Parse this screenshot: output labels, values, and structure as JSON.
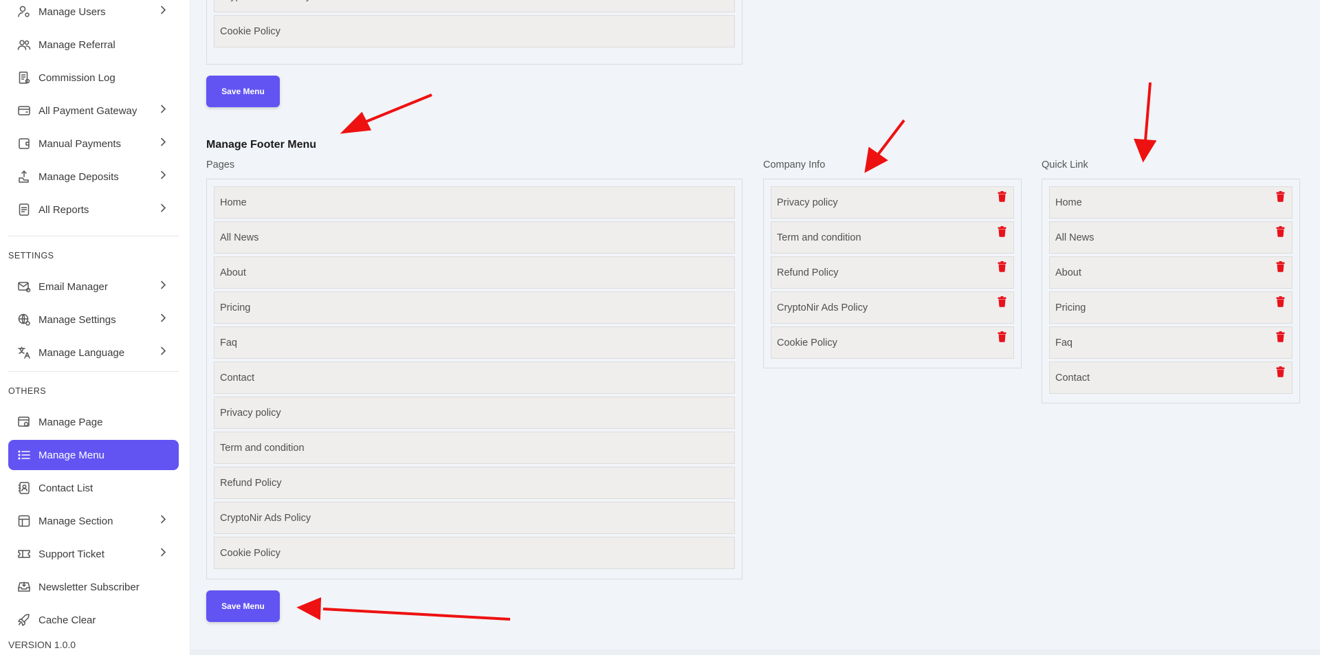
{
  "sidebar": {
    "items_top": [
      {
        "label": "Manage Users",
        "icon": "user-gear-icon",
        "chevron": true
      },
      {
        "label": "Manage Referral",
        "icon": "users-icon",
        "chevron": false
      },
      {
        "label": "Commission Log",
        "icon": "receipt-icon",
        "chevron": false
      },
      {
        "label": "All Payment Gateway",
        "icon": "wallet-icon",
        "chevron": true
      },
      {
        "label": "Manual Payments",
        "icon": "wallet-alt-icon",
        "chevron": true
      },
      {
        "label": "Manage Deposits",
        "icon": "deposit-icon",
        "chevron": true
      },
      {
        "label": "All Reports",
        "icon": "report-icon",
        "chevron": true
      }
    ],
    "settings_title": "SETTINGS",
    "items_settings": [
      {
        "label": "Email Manager",
        "icon": "mail-gear-icon",
        "chevron": true
      },
      {
        "label": "Manage Settings",
        "icon": "globe-gear-icon",
        "chevron": true
      },
      {
        "label": "Manage Language",
        "icon": "translate-icon",
        "chevron": true
      }
    ],
    "others_title": "OTHERS",
    "items_others": [
      {
        "label": "Manage Page",
        "icon": "page-gear-icon",
        "chevron": false
      },
      {
        "label": "Manage Menu",
        "icon": "list-icon",
        "chevron": false,
        "active": true
      },
      {
        "label": "Contact List",
        "icon": "contact-icon",
        "chevron": false
      },
      {
        "label": "Manage Section",
        "icon": "layout-icon",
        "chevron": true
      },
      {
        "label": "Support Ticket",
        "icon": "ticket-icon",
        "chevron": true
      },
      {
        "label": "Newsletter Subscriber",
        "icon": "inbox-icon",
        "chevron": false
      },
      {
        "label": "Cache Clear",
        "icon": "rocket-icon",
        "chevron": false
      }
    ],
    "version": "VERSION 1.0.0"
  },
  "top_section": {
    "items": [
      "CryptoNir Ads Policy",
      "Cookie Policy"
    ],
    "save_label": "Save Menu"
  },
  "footer_menu": {
    "heading": "Manage Footer Menu",
    "pages": {
      "label": "Pages",
      "items": [
        "Home",
        "All News",
        "About",
        "Pricing",
        "Faq",
        "Contact",
        "Privacy policy",
        "Term and condition",
        "Refund Policy",
        "CryptoNir Ads Policy",
        "Cookie Policy"
      ]
    },
    "company_info": {
      "label": "Company Info",
      "items": [
        "Privacy policy",
        "Term and condition",
        "Refund Policy",
        "CryptoNir Ads Policy",
        "Cookie Policy"
      ]
    },
    "quick_link": {
      "label": "Quick Link",
      "items": [
        "Home",
        "All News",
        "About",
        "Pricing",
        "Faq",
        "Contact"
      ]
    },
    "save_label": "Save Menu"
  },
  "colors": {
    "accent": "#6254f3",
    "delete": "#e8121b",
    "annotation_arrow": "#ee1111"
  }
}
